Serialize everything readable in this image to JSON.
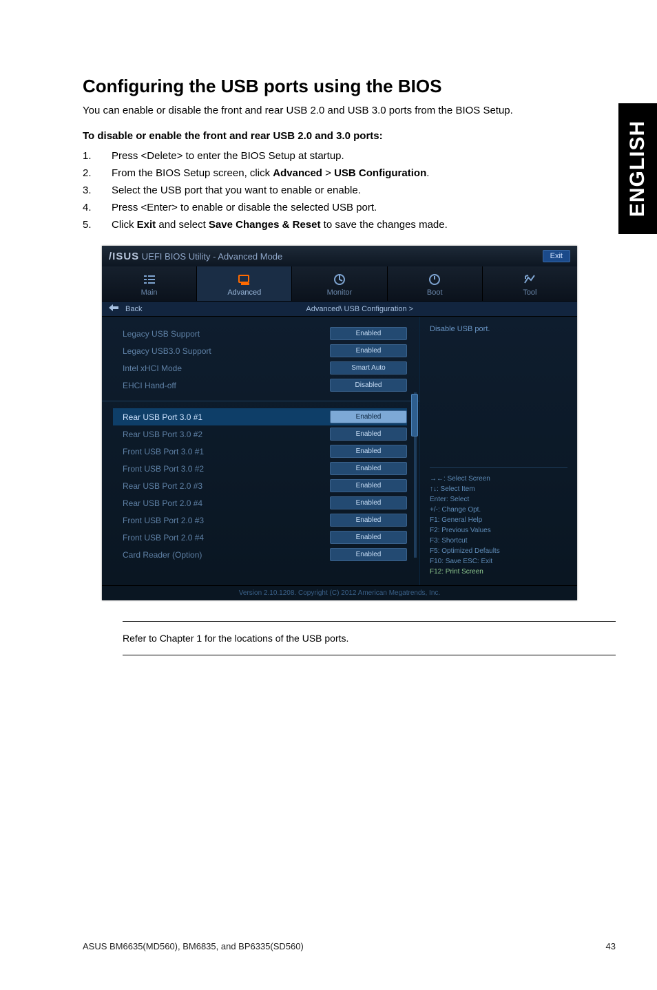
{
  "side_tab": "ENGLISH",
  "heading": "Configuring the USB ports using the BIOS",
  "intro": "You can enable or disable the front and rear USB 2.0 and USB 3.0 ports from the BIOS Setup.",
  "subheading": "To disable or enable the front and rear USB 2.0 and 3.0 ports:",
  "steps": [
    {
      "num": "1.",
      "pre": "Press <Delete> to enter the BIOS Setup at startup.",
      "b1": "",
      "mid": "",
      "b2": "",
      "post": ""
    },
    {
      "num": "2.",
      "pre": "From the BIOS Setup screen, click ",
      "b1": "Advanced",
      "mid": " > ",
      "b2": "USB Configuration",
      "post": "."
    },
    {
      "num": "3.",
      "pre": "Select the USB port that you want to enable or enable.",
      "b1": "",
      "mid": "",
      "b2": "",
      "post": ""
    },
    {
      "num": "4.",
      "pre": "Press <Enter> to enable or disable the selected USB port.",
      "b1": "",
      "mid": "",
      "b2": "",
      "post": ""
    },
    {
      "num": "5.",
      "pre": "Click ",
      "b1": "Exit",
      "mid": " and select ",
      "b2": "Save Changes & Reset",
      "post": " to save the changes made."
    }
  ],
  "bios": {
    "title_brand": "/ISUS",
    "title_text": " UEFI BIOS Utility - Advanced Mode",
    "exit_btn": "Exit",
    "tabs": [
      "Main",
      "Advanced",
      "Monitor",
      "Boot",
      "Tool"
    ],
    "active_tab_index": 1,
    "back_label": "Back",
    "breadcrumb": "Advanced\\ USB Configuration >",
    "top_rows": [
      {
        "label": "Legacy USB Support",
        "value": "Enabled"
      },
      {
        "label": "Legacy USB3.0 Support",
        "value": "Enabled"
      },
      {
        "label": "Intel xHCI Mode",
        "value": "Smart Auto"
      },
      {
        "label": "EHCI Hand-off",
        "value": "Disabled"
      }
    ],
    "port_rows": [
      {
        "label": "Rear  USB Port 3.0 #1",
        "value": "Enabled",
        "highlight": true
      },
      {
        "label": "Rear  USB Port 3.0 #2",
        "value": "Enabled"
      },
      {
        "label": "Front USB Port 3.0 #1",
        "value": "Enabled"
      },
      {
        "label": "Front USB Port 3.0 #2",
        "value": "Enabled"
      },
      {
        "label": "Rear  USB Port 2.0 #3",
        "value": "Enabled"
      },
      {
        "label": "Rear  USB Port 2.0 #4",
        "value": "Enabled"
      },
      {
        "label": "Front USB Port 2.0 #3",
        "value": "Enabled"
      },
      {
        "label": "Front USB Port 2.0 #4",
        "value": "Enabled"
      },
      {
        "label": "Card  Reader (Option)",
        "value": "Enabled"
      }
    ],
    "hint": "Disable USB port.",
    "help_keys": [
      "→←: Select Screen",
      "↑↓: Select Item",
      "Enter: Select",
      "+/-: Change Opt.",
      "F1: General Help",
      "F2: Previous Values",
      "F3: Shortcut",
      "F5: Optimized Defaults",
      "F10: Save  ESC: Exit",
      "F12: Print Screen"
    ],
    "footer": "Version 2.10.1208. Copyright (C) 2012 American Megatrends, Inc."
  },
  "note": "Refer to Chapter 1 for the locations of the USB ports.",
  "page_footer_left": "ASUS BM6635(MD560), BM6835, and BP6335(SD560)",
  "page_footer_right": "43"
}
